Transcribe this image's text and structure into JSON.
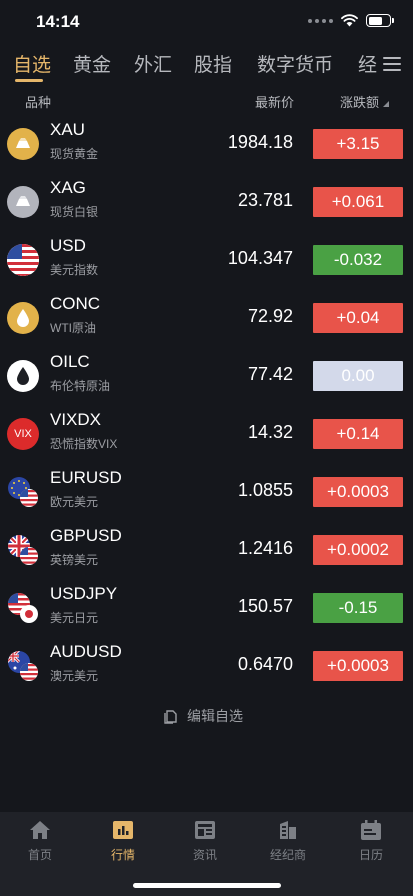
{
  "status_bar": {
    "time": "14:14"
  },
  "tabs": [
    "自选",
    "黄金",
    "外汇",
    "股指",
    "数字货币",
    "经"
  ],
  "header": {
    "name": "品种",
    "price": "最新价",
    "change": "涨跌额"
  },
  "rows": [
    {
      "symbol": "XAU",
      "name": "现货黄金",
      "price": "1984.18",
      "change": "+3.15",
      "trend": "up",
      "icon": "gold-bar-icon"
    },
    {
      "symbol": "XAG",
      "name": "现货白银",
      "price": "23.781",
      "change": "+0.061",
      "trend": "up",
      "icon": "silver-bar-icon"
    },
    {
      "symbol": "USD",
      "name": "美元指数",
      "price": "104.347",
      "change": "-0.032",
      "trend": "down",
      "icon": "us-flag-icon"
    },
    {
      "symbol": "CONC",
      "name": "WTI原油",
      "price": "72.92",
      "change": "+0.04",
      "trend": "up",
      "icon": "oil-drop-gold-icon"
    },
    {
      "symbol": "OILC",
      "name": "布伦特原油",
      "price": "77.42",
      "change": "0.00",
      "trend": "flat",
      "icon": "oil-drop-white-icon"
    },
    {
      "symbol": "VIXDX",
      "name": "恐慌指数VIX",
      "price": "14.32",
      "change": "+0.14",
      "trend": "up",
      "icon": "vix-icon",
      "icon_text": "VIX"
    },
    {
      "symbol": "EURUSD",
      "name": "欧元美元",
      "price": "1.0855",
      "change": "+0.0003",
      "trend": "up",
      "icon": "eu-us-flag-icon"
    },
    {
      "symbol": "GBPUSD",
      "name": "英镑美元",
      "price": "1.2416",
      "change": "+0.0002",
      "trend": "up",
      "icon": "uk-us-flag-icon"
    },
    {
      "symbol": "USDJPY",
      "name": "美元日元",
      "price": "150.57",
      "change": "-0.15",
      "trend": "down",
      "icon": "us-jp-flag-icon"
    },
    {
      "symbol": "AUDUSD",
      "name": "澳元美元",
      "price": "0.6470",
      "change": "+0.0003",
      "trend": "up",
      "icon": "au-us-flag-icon"
    }
  ],
  "edit_label": "编辑自选",
  "nav": [
    {
      "label": "首页",
      "icon": "home-icon",
      "active": false
    },
    {
      "label": "行情",
      "icon": "market-chart-icon",
      "active": true
    },
    {
      "label": "资讯",
      "icon": "news-icon",
      "active": false
    },
    {
      "label": "经纪商",
      "icon": "broker-building-icon",
      "active": false
    },
    {
      "label": "日历",
      "icon": "calendar-icon",
      "active": false
    }
  ],
  "colors": {
    "up": "#e8544a",
    "down": "#4aa144",
    "flat": "#d3d9ea",
    "accent": "#e5b66a",
    "background": "#15171c"
  }
}
